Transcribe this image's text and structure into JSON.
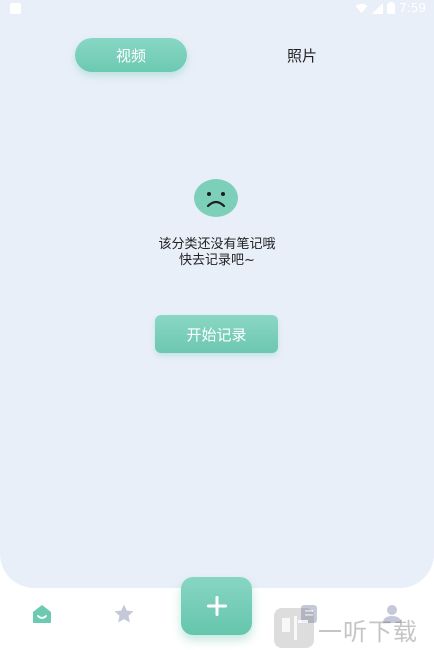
{
  "status_bar": {
    "time": "7:59"
  },
  "tabs": [
    {
      "label": "视频",
      "active": true
    },
    {
      "label": "照片",
      "active": false
    }
  ],
  "empty_state": {
    "line1": "该分类还没有笔记哦",
    "line2": "快去记录吧~",
    "icon": "sad-face-icon"
  },
  "actions": {
    "start_label": "开始记录"
  },
  "bottom_nav": {
    "items": [
      {
        "icon": "home-icon",
        "active": true
      },
      {
        "icon": "star-icon",
        "active": false
      },
      {
        "icon": "plus-icon",
        "primary": true
      },
      {
        "icon": "notes-icon",
        "active": false
      },
      {
        "icon": "profile-icon",
        "active": false
      }
    ]
  },
  "watermark": {
    "text": "一听下载"
  },
  "colors": {
    "accent": "#6cc9b2",
    "background": "#e9eff9",
    "inactive_icon": "#c4c8d8"
  }
}
